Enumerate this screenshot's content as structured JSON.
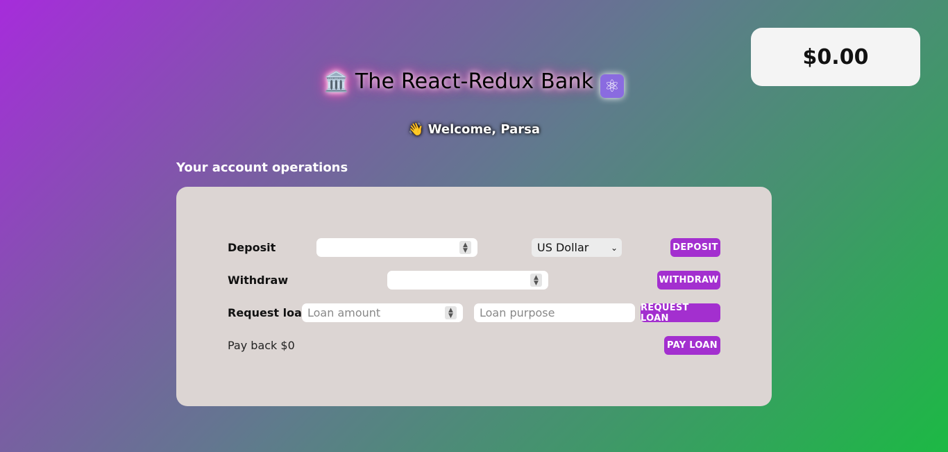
{
  "balance": "$0.00",
  "header": {
    "bank_icon": "🏛️",
    "title": "The React-Redux Bank",
    "atom_icon": "⚛"
  },
  "welcome": {
    "wave_icon": "👋",
    "text": "Welcome, Parsa"
  },
  "section_heading": "Your account operations",
  "operations": {
    "deposit": {
      "label": "Deposit",
      "amount_value": "",
      "currency_selected": "US Dollar",
      "button_label": "DEPOSIT"
    },
    "withdraw": {
      "label": "Withdraw",
      "amount_value": "",
      "button_label": "WITHDRAW"
    },
    "loan": {
      "label": "Request loan",
      "amount_placeholder": "Loan amount",
      "purpose_placeholder": "Loan purpose",
      "button_label": "REQUEST LOAN"
    },
    "payback": {
      "label": "Pay back $0",
      "button_label": "PAY LOAN"
    }
  },
  "colors": {
    "button": "#a32fcf",
    "panel": "#dcd5d3"
  }
}
